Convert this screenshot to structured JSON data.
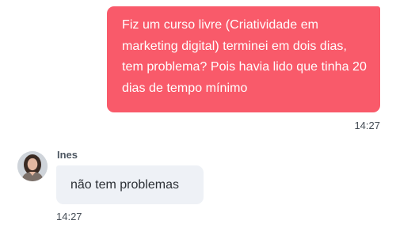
{
  "conversation": {
    "outgoing": {
      "text": "Fiz um curso livre (Criatividade em marketing digital) terminei em dois dias, tem problema? Pois havia lido que tinha 20 dias de tempo mínimo",
      "time": "14:27",
      "bubble_color": "#f95a6a"
    },
    "incoming": {
      "sender": "Ines",
      "text": "não tem problemas",
      "time": "14:27",
      "bubble_color": "#eef1f6",
      "avatar_icon": "user-photo-avatar"
    }
  }
}
